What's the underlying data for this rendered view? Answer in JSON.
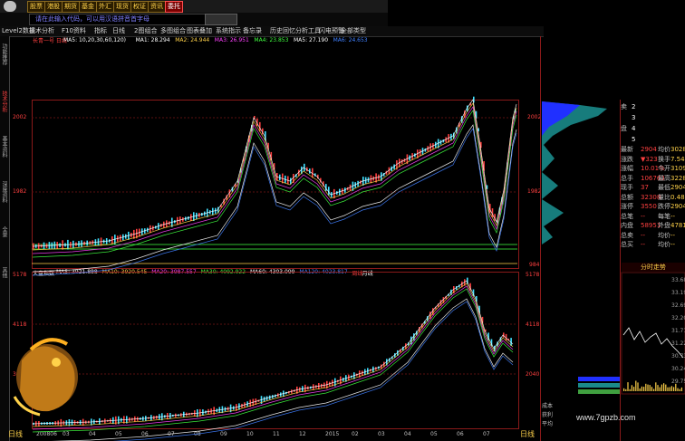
{
  "toolbar": {
    "buttons": [
      "股票",
      "港股",
      "期货",
      "基金",
      "外汇",
      "现货",
      "权证",
      "资讯",
      "委托"
    ],
    "active_index": 8
  },
  "search": {
    "placeholder": "请在此输入代码，可以用汉语拼音首字母"
  },
  "menu": {
    "level2": "Level2数据",
    "items": [
      "技术分析",
      "F10资料",
      "指标",
      "日线",
      "2图组合",
      "多图组合",
      "图表叠加",
      "系统指示",
      "备忘录",
      "历史回忆",
      "分析工具",
      "闪电预警",
      "全部类型"
    ]
  },
  "side_tabs": [
    "功能推荐",
    "技术分析",
    "基本资料",
    "深度资料",
    "全景",
    "其他"
  ],
  "upper_chart": {
    "title": "长青一号 日线",
    "ma": [
      {
        "label": "MA5: 10,20,30,60,120)",
        "color": "#ffffff"
      },
      {
        "label": "MA1: 28.294",
        "color": "#ffffff"
      },
      {
        "label": "MA2: 24.944",
        "color": "#ffd24a"
      },
      {
        "label": "MA3: 26.951",
        "color": "#ff40ff"
      },
      {
        "label": "MA4: 23.853",
        "color": "#40ff40"
      },
      {
        "label": "MA5: 27.190",
        "color": "#ffffff"
      },
      {
        "label": "MA6: 24.653",
        "color": "#4080ff"
      }
    ],
    "y_labels": [
      "2002",
      "1982"
    ],
    "right_labels": [
      "2002",
      "1982",
      "984"
    ]
  },
  "lower_chart": {
    "title": "大盘指数",
    "ma": [
      {
        "label": "MA5: 3921.888",
        "color": "#ffffff"
      },
      {
        "label": "MA10: 3920.545",
        "color": "#ffd24a"
      },
      {
        "label": "MA20: 3987.557",
        "color": "#ff40ff"
      },
      {
        "label": "MA30: 4092.922",
        "color": "#40ff40"
      },
      {
        "label": "MA60: 4303.099",
        "color": "#ffffff"
      },
      {
        "label": "MA120: 4023.817",
        "color": "#4080ff"
      },
      {
        "label": "周线",
        "color": "#ff4040"
      },
      {
        "label": "月线",
        "color": "#ffffff"
      }
    ],
    "y_labels": [
      "5178",
      "4118",
      "3056",
      "2040"
    ],
    "date_labels": [
      "200806",
      "03",
      "04",
      "05",
      "06",
      "07",
      "08",
      "09",
      "10",
      "11",
      "12",
      "2015",
      "02",
      "03",
      "04",
      "05",
      "06",
      "07"
    ]
  },
  "bottom_tab": "日线",
  "bottom_tab_right": "日线",
  "quote": {
    "order_rows": [
      {
        "k": "卖",
        "v": "2"
      },
      {
        "k": "",
        "v": "3"
      },
      {
        "k": "盘",
        "v": "4"
      },
      {
        "k": "",
        "v": "5"
      }
    ],
    "rows": [
      {
        "k": "最新",
        "v": "2904",
        "k2": "均价",
        "v2": "3028"
      },
      {
        "k": "涨跌",
        "v": "▼323",
        "k2": "换手",
        "v2": "7.54%"
      },
      {
        "k": "涨幅",
        "v": "10.01%",
        "k2": "今开",
        "v2": "3109"
      },
      {
        "k": "总手",
        "v": "106763",
        "k2": "最高",
        "v2": "3228"
      },
      {
        "k": "现手",
        "v": "37",
        "k2": "最低",
        "v2": "2904"
      },
      {
        "k": "总额",
        "v": "32308",
        "k2": "量比",
        "v2": "0.48"
      },
      {
        "k": "涨停",
        "v": "3550",
        "k2": "跌停",
        "v2": "2904"
      },
      {
        "k": "总笔",
        "v": "--",
        "k2": "每笔",
        "v2": "--"
      },
      {
        "k": "内盘",
        "v": "58951",
        "k2": "外盘",
        "v2": "47813"
      },
      {
        "k": "总卖",
        "v": "--",
        "k2": "均价",
        "v2": "--"
      },
      {
        "k": "总买",
        "v": "--",
        "k2": "均价",
        "v2": "--"
      }
    ],
    "mini_title": "分时走势",
    "mini_prices": [
      "33.68",
      "33.19",
      "32.69",
      "32.20",
      "31.71",
      "31.22",
      "30.73",
      "30.24",
      "29.75"
    ]
  },
  "side_small": [
    "成本",
    "获利",
    "平均"
  ],
  "watermark": "www.7gpzb.com",
  "colors": {
    "up": "#ff4040",
    "down": "#40e0ff",
    "accent": "#ffd24a",
    "frame": "#8a1a1a"
  }
}
